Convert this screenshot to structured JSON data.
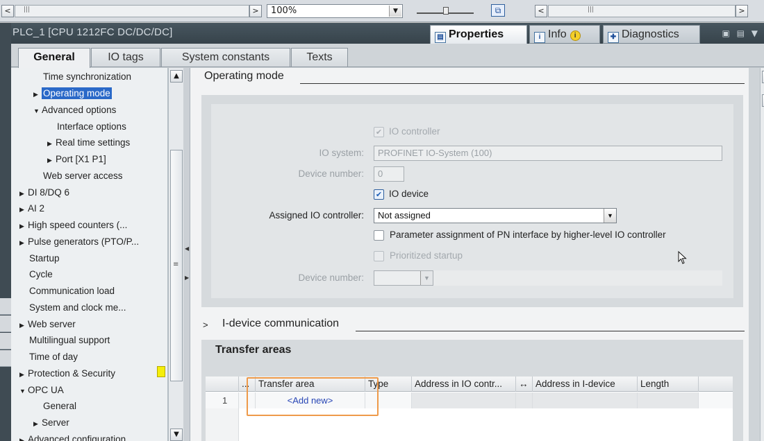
{
  "toolbar": {
    "zoom_value": "100%",
    "scroll_left_icon": "<",
    "scroll_right_icon": ">",
    "grip": "|||"
  },
  "window": {
    "title": "PLC_1 [CPU 1212FC DC/DC/DC]",
    "tabs": [
      {
        "label": "Properties",
        "icon": "properties-icon"
      },
      {
        "label": "Info",
        "icon": "info-icon"
      },
      {
        "label": "Diagnostics",
        "icon": "diagnostics-icon"
      }
    ]
  },
  "subtabs": [
    "General",
    "IO tags",
    "System constants",
    "Texts"
  ],
  "tree": {
    "items": [
      {
        "label": "Time synchronization",
        "indent": 2,
        "arrow": ""
      },
      {
        "label": "Operating mode",
        "indent": 2,
        "arrow": "right",
        "selected": true
      },
      {
        "label": "Advanced options",
        "indent": 2,
        "arrow": "down"
      },
      {
        "label": "Interface options",
        "indent": 3,
        "arrow": ""
      },
      {
        "label": "Real time settings",
        "indent": 3,
        "arrow": "right"
      },
      {
        "label": "Port [X1 P1]",
        "indent": 3,
        "arrow": "right"
      },
      {
        "label": "Web server access",
        "indent": 2,
        "arrow": ""
      },
      {
        "label": "DI 8/DQ 6",
        "indent": 0,
        "arrow": "right"
      },
      {
        "label": "AI 2",
        "indent": 0,
        "arrow": "right"
      },
      {
        "label": "High speed counters (...",
        "indent": 0,
        "arrow": "right"
      },
      {
        "label": "Pulse generators (PTO/P...",
        "indent": 0,
        "arrow": "right"
      },
      {
        "label": "Startup",
        "indent": 1,
        "arrow": ""
      },
      {
        "label": "Cycle",
        "indent": 1,
        "arrow": ""
      },
      {
        "label": "Communication load",
        "indent": 1,
        "arrow": ""
      },
      {
        "label": "System and clock me...",
        "indent": 1,
        "arrow": ""
      },
      {
        "label": "Web server",
        "indent": 0,
        "arrow": "right"
      },
      {
        "label": "Multilingual support",
        "indent": 1,
        "arrow": ""
      },
      {
        "label": "Time of day",
        "indent": 1,
        "arrow": ""
      },
      {
        "label": "Protection & Security",
        "indent": 0,
        "arrow": "right"
      },
      {
        "label": "OPC UA",
        "indent": 0,
        "arrow": "down"
      },
      {
        "label": "General",
        "indent": 2,
        "arrow": ""
      },
      {
        "label": "Server",
        "indent": 2,
        "arrow": "right"
      },
      {
        "label": "Advanced configuration",
        "indent": 0,
        "arrow": "right"
      }
    ]
  },
  "operating_mode": {
    "heading": "Operating mode",
    "io_controller_label": "IO controller",
    "io_system_label": "IO system:",
    "io_system_value": "PROFINET IO-System (100)",
    "device_number_label": "Device number:",
    "device_number_value": "0",
    "io_device_label": "IO device",
    "assigned_controller_label": "Assigned IO controller:",
    "assigned_controller_value": "Not assigned",
    "param_assignment_label": "Parameter assignment of PN interface by higher-level IO controller",
    "prioritized_startup_label": "Prioritized startup",
    "device_number2_label": "Device number:"
  },
  "idevice": {
    "heading": "I-device communication",
    "expand": ">"
  },
  "transfer": {
    "heading": "Transfer areas",
    "columns": [
      "...",
      "Transfer area",
      "Type",
      "Address in IO contr...",
      "↔",
      "Address in I-device",
      "Length"
    ],
    "rows": [
      {
        "num": "1",
        "name": "<Add new>"
      }
    ]
  },
  "colors": {
    "accent": "#2a69c8",
    "highlight": "#ee9a4a",
    "warning_flag": "#f5ee0a"
  }
}
